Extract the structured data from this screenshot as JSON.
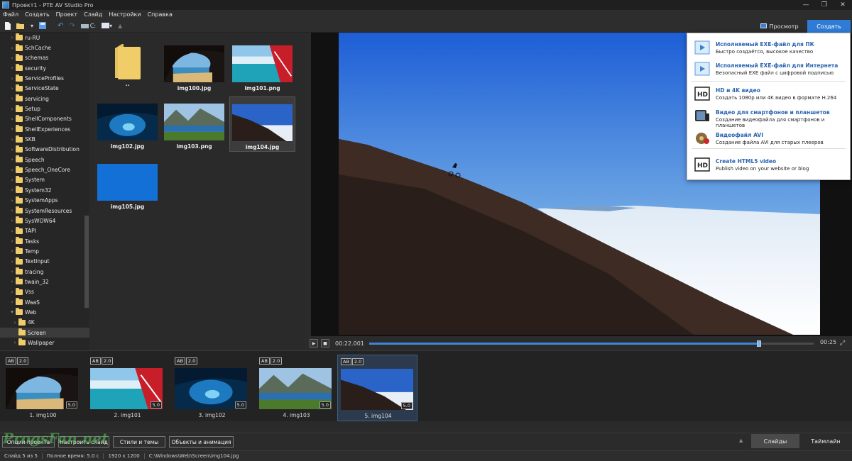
{
  "window": {
    "title": "Проект1 - PTE AV Studio Pro"
  },
  "menu": [
    "Файл",
    "Создать",
    "Проект",
    "Слайд",
    "Настройки",
    "Справка"
  ],
  "toolbar": {
    "drive_label": "C:"
  },
  "header": {
    "preview_label": "Просмотр",
    "create_label": "Создать"
  },
  "folder_tree": [
    {
      "label": "ru-RU",
      "expanded": false,
      "indent": 1
    },
    {
      "label": "SchCache",
      "expanded": false,
      "indent": 1
    },
    {
      "label": "schemas",
      "expanded": false,
      "indent": 1
    },
    {
      "label": "security",
      "expanded": false,
      "indent": 1
    },
    {
      "label": "ServiceProfiles",
      "expanded": false,
      "indent": 1
    },
    {
      "label": "ServiceState",
      "expanded": false,
      "indent": 1
    },
    {
      "label": "servicing",
      "expanded": false,
      "indent": 1
    },
    {
      "label": "Setup",
      "expanded": false,
      "indent": 1
    },
    {
      "label": "ShellComponents",
      "expanded": false,
      "indent": 1
    },
    {
      "label": "ShellExperiences",
      "expanded": false,
      "indent": 1
    },
    {
      "label": "SKB",
      "expanded": false,
      "indent": 1
    },
    {
      "label": "SoftwareDistribution",
      "expanded": false,
      "indent": 1
    },
    {
      "label": "Speech",
      "expanded": false,
      "indent": 1
    },
    {
      "label": "Speech_OneCore",
      "expanded": false,
      "indent": 1
    },
    {
      "label": "System",
      "expanded": false,
      "indent": 1
    },
    {
      "label": "System32",
      "expanded": false,
      "indent": 1
    },
    {
      "label": "SystemApps",
      "expanded": false,
      "indent": 1
    },
    {
      "label": "SystemResources",
      "expanded": false,
      "indent": 1
    },
    {
      "label": "SysWOW64",
      "expanded": false,
      "indent": 1
    },
    {
      "label": "TAPI",
      "expanded": false,
      "indent": 1
    },
    {
      "label": "Tasks",
      "expanded": false,
      "indent": 1
    },
    {
      "label": "Temp",
      "expanded": false,
      "indent": 1
    },
    {
      "label": "TextInput",
      "expanded": false,
      "indent": 1
    },
    {
      "label": "tracing",
      "expanded": false,
      "indent": 1
    },
    {
      "label": "twain_32",
      "expanded": false,
      "indent": 1
    },
    {
      "label": "Vss",
      "expanded": false,
      "indent": 1
    },
    {
      "label": "WaaS",
      "expanded": false,
      "indent": 1
    },
    {
      "label": "Web",
      "expanded": true,
      "indent": 1
    },
    {
      "label": "4K",
      "expanded": false,
      "indent": 2
    },
    {
      "label": "Screen",
      "expanded": false,
      "indent": 2,
      "selected": true
    },
    {
      "label": "Wallpaper",
      "expanded": false,
      "indent": 2
    }
  ],
  "files": [
    {
      "name": "..",
      "kind": "folder"
    },
    {
      "name": "img100.jpg",
      "kind": "cave"
    },
    {
      "name": "img101.png",
      "kind": "beach"
    },
    {
      "name": "img102.jpg",
      "kind": "underwater"
    },
    {
      "name": "img103.png",
      "kind": "lake"
    },
    {
      "name": "img104.jpg",
      "kind": "mountain",
      "selected": true
    },
    {
      "name": "img105.jpg",
      "kind": "blue"
    }
  ],
  "playback": {
    "current_time": "00:22.001",
    "duration": "00:25",
    "progress": 0.877
  },
  "create_menu": [
    {
      "icon": "exe-pc-icon",
      "title": "Исполняемый EXE-файл для ПК",
      "desc": "Быстро создаётся, высокое качество"
    },
    {
      "icon": "exe-web-icon",
      "title": "Исполняемый EXE-файл для Интернета",
      "desc": "Безопасный EXE файл с цифровой подписью"
    },
    {
      "icon": "hd-icon",
      "title": "HD и 4K видео",
      "desc": "Создать 1080p или 4K видео в формате H.264"
    },
    {
      "icon": "tablet-icon",
      "title": "Видео для смартфонов и планшетов",
      "desc": "Создание видеофайла для смартфонов и планшетов"
    },
    {
      "icon": "film-reel-icon",
      "title": "Видеофайл AVI",
      "desc": "Создание файла AVI для старых плееров"
    },
    {
      "icon": "hd-icon",
      "title": "Create HTML5 video",
      "desc": "Publish video on your website or blog"
    }
  ],
  "slides": [
    {
      "name": "1. img100",
      "kind": "cave",
      "ab": "AB",
      "transition": "2.0",
      "duration": "5.0"
    },
    {
      "name": "2. img101",
      "kind": "beach",
      "ab": "AB",
      "transition": "2.0",
      "duration": "5.0"
    },
    {
      "name": "3. img102",
      "kind": "underwater",
      "ab": "AB",
      "transition": "2.0",
      "duration": "5.0"
    },
    {
      "name": "4. img103",
      "kind": "lake",
      "ab": "AB",
      "transition": "2.0",
      "duration": "5.0"
    },
    {
      "name": "5. img104",
      "kind": "mountain",
      "ab": "AB",
      "transition": "2.0",
      "duration": "5.0",
      "selected": true
    }
  ],
  "bottom_buttons": [
    "Опции проекта",
    "Настроить слайд",
    "Стили и темы",
    "Объекты и анимация"
  ],
  "view_tabs": {
    "slides": "Слайды",
    "timeline": "Таймлайн",
    "active": "slides"
  },
  "status": {
    "slide": "Слайд 5 из 5",
    "total": "Полное время: 5.0 с",
    "resolution": "1920 x 1200",
    "path": "C:\\Windows\\Web\\Screen\\img104.jpg"
  },
  "watermark": "ProgsFan.net",
  "colors": {
    "accent": "#2f7bd6",
    "menu_title": "#2a64b0",
    "folder": "#f1cd6a"
  }
}
